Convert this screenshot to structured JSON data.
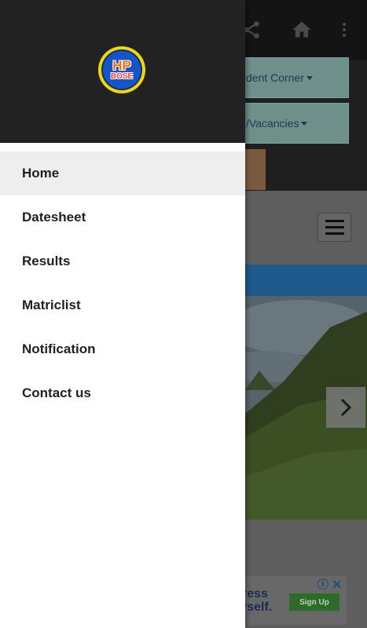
{
  "appbar": {
    "actions": [
      {
        "icon": "share-icon"
      },
      {
        "icon": "home-icon"
      },
      {
        "icon": "more-vert-icon"
      }
    ]
  },
  "background_page": {
    "menu_buttons": [
      {
        "label": "dent Corner"
      },
      {
        "label": "/Vacancies"
      }
    ],
    "carousel_next_icon": "chevron-right-icon",
    "ad": {
      "text_line1": "ress",
      "text_line2": "rself.",
      "button_label": "Sign Up",
      "info_icon": "i",
      "close_icon": "✕"
    }
  },
  "drawer": {
    "logo": {
      "line1": "HP",
      "line2": "BOSE"
    },
    "items": [
      {
        "label": "Home",
        "active": true
      },
      {
        "label": "Datesheet"
      },
      {
        "label": "Results"
      },
      {
        "label": "Matriclist"
      },
      {
        "label": "Notification"
      },
      {
        "label": "Contact us"
      }
    ]
  },
  "colors": {
    "drawer_header": "#222222",
    "active_item_bg": "#eeeeee",
    "logo_ring": "#f5d800",
    "logo_fill": "#1456c8"
  }
}
